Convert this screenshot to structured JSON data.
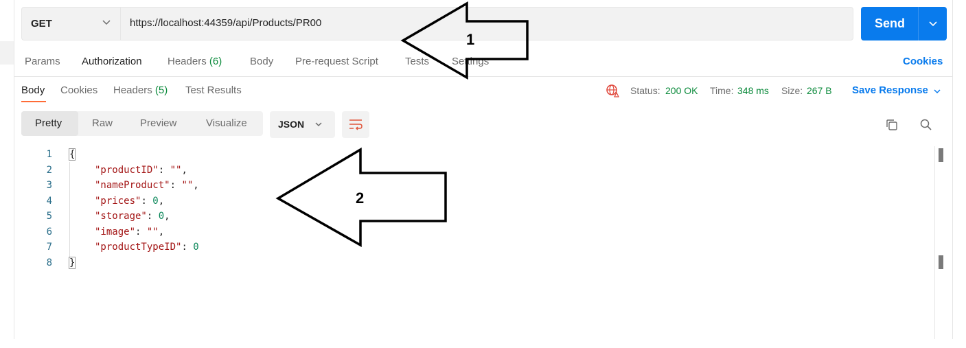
{
  "request": {
    "method": "GET",
    "url": "https://localhost:44359/api/Products/PR00",
    "send_label": "Send",
    "tabs": [
      {
        "label": "Params"
      },
      {
        "label": "Authorization"
      },
      {
        "label": "Headers",
        "count": "(6)"
      },
      {
        "label": "Body"
      },
      {
        "label": "Pre-request Script"
      },
      {
        "label": "Tests"
      },
      {
        "label": "Settings"
      }
    ],
    "cookies_label": "Cookies"
  },
  "response": {
    "tabs": [
      {
        "label": "Body"
      },
      {
        "label": "Cookies"
      },
      {
        "label": "Headers",
        "count": "(5)"
      },
      {
        "label": "Test Results"
      }
    ],
    "status_label": "Status:",
    "status_value": "200 OK",
    "time_label": "Time:",
    "time_value": "348 ms",
    "size_label": "Size:",
    "size_value": "267 B",
    "save_label": "Save Response",
    "view_modes": [
      "Pretty",
      "Raw",
      "Preview",
      "Visualize"
    ],
    "format": "JSON",
    "code_lines": [
      {
        "n": "1",
        "text": "{"
      },
      {
        "n": "2",
        "key": "\"productID\"",
        "sep": ": ",
        "val": "\"\"",
        "tail": ","
      },
      {
        "n": "3",
        "key": "\"nameProduct\"",
        "sep": ": ",
        "val": "\"\"",
        "tail": ","
      },
      {
        "n": "4",
        "key": "\"prices\"",
        "sep": ": ",
        "val": "0",
        "tail": ","
      },
      {
        "n": "5",
        "key": "\"storage\"",
        "sep": ": ",
        "val": "0",
        "tail": ","
      },
      {
        "n": "6",
        "key": "\"image\"",
        "sep": ": ",
        "val": "\"\"",
        "tail": ","
      },
      {
        "n": "7",
        "key": "\"productTypeID\"",
        "sep": ": ",
        "val": "0",
        "tail": ""
      },
      {
        "n": "8",
        "text": "}"
      }
    ]
  },
  "annotations": {
    "arrow1_label": "1",
    "arrow2_label": "2"
  },
  "colors": {
    "accent": "#097bed",
    "active_tab": "#ff6c37",
    "success": "#0b8a3b"
  },
  "icons": [
    "chevron-down-icon",
    "globe-warning-icon",
    "wrap-lines-icon",
    "copy-icon",
    "search-icon"
  ]
}
